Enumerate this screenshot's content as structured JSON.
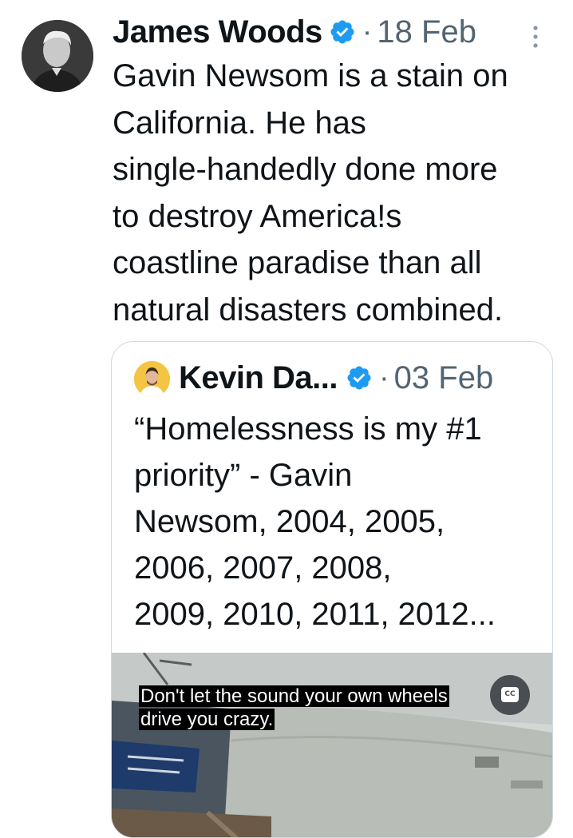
{
  "tweet": {
    "author": "James Woods",
    "separator": "·",
    "date": "18 Feb",
    "text": "Gavin Newsom is a stain on\nCalifornia. He has\nsingle-handedly done more\nto destroy America!s\ncoastline paradise than all\nnatural disasters combined.",
    "avatar_icon": "user-avatar-icon",
    "verified_icon": "verified-badge-icon",
    "more_icon": "more-options-icon"
  },
  "quote": {
    "author": "Kevin Da...",
    "separator": "·",
    "date": "03 Feb",
    "text": "“Homelessness is my #1\npriority” - Gavin\nNewsom, 2004, 2005,\n2006, 2007, 2008,\n2009, 2010, 2011, 2012...",
    "media": {
      "caption_line1": "Don't let the sound your own wheels",
      "caption_line2": "drive you crazy.",
      "cc_label": "CC"
    }
  },
  "colors": {
    "text_primary": "#0f1419",
    "text_secondary": "#536471",
    "verified_blue": "#1d9bf0",
    "border": "#cfd9de"
  }
}
